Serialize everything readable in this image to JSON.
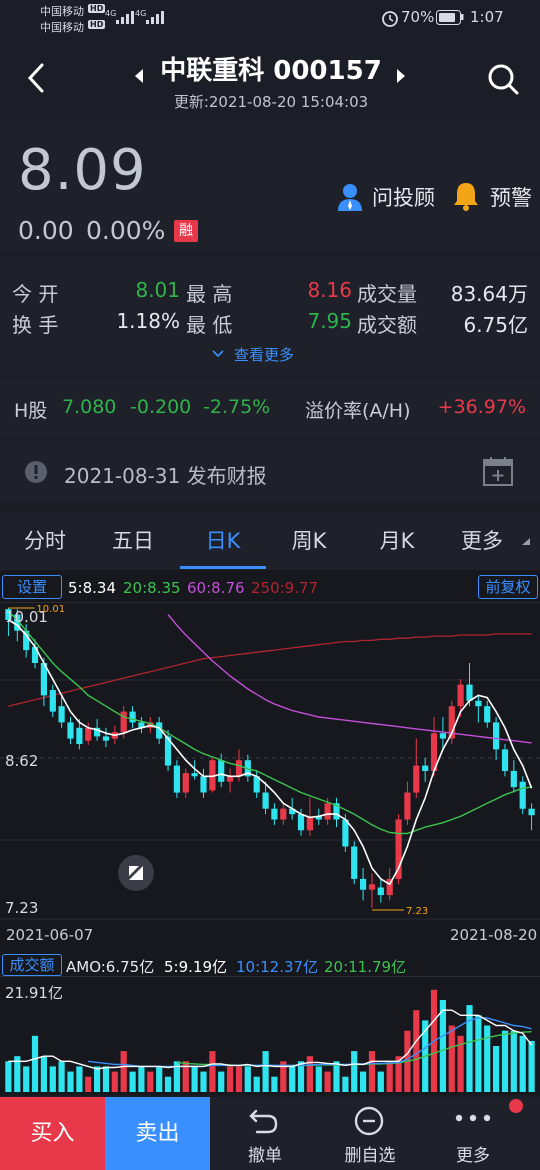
{
  "status_bar": {
    "carrier1": "中国移动",
    "carrier2": "中国移动",
    "hd": "HD",
    "net1": "4G",
    "net2": "4G",
    "battery": "70%",
    "time": "1:07"
  },
  "header": {
    "title": "中联重科 000157",
    "updated": "更新:2021-08-20 15:04:03"
  },
  "quote": {
    "price": "8.09",
    "change": "0.00",
    "change_pct": "0.00%",
    "margin_badge": "融",
    "advisor_label": "问投顾",
    "alert_label": "预警"
  },
  "stats": {
    "open_label": "今 开",
    "open_value": "8.01",
    "high_label": "最 高",
    "high_value": "8.16",
    "volume_label": "成交量",
    "volume_value": "83.64万",
    "turnover_label": "换 手",
    "turnover_value": "1.18%",
    "low_label": "最 低",
    "low_value": "7.95",
    "amount_label": "成交额",
    "amount_value": "6.75亿",
    "more_label": "查看更多"
  },
  "hshare": {
    "label": "H股",
    "price": "7.080",
    "change": "-0.200",
    "change_pct": "-2.75%",
    "premium_label": "溢价率(A/H)",
    "premium_value": "+36.97%"
  },
  "notice": {
    "text": "2021-08-31 发布财报"
  },
  "tabs": [
    "分时",
    "五日",
    "日K",
    "周K",
    "月K",
    "更多"
  ],
  "active_tab": "日K",
  "chart": {
    "settings_label": "设置",
    "ma5": "5:8.34",
    "ma20": "20:8.35",
    "ma60": "60:8.76",
    "ma250": "250:9.77",
    "adjust_label": "前复权",
    "y_top": "10.01",
    "y_mid": "8.62",
    "y_bottom": "7.23",
    "high_marker": "10.01",
    "low_marker": "7.23",
    "date_start": "2021-06-07",
    "date_end": "2021-08-20",
    "vol_label": "成交额",
    "amo": "AMO:6.75亿",
    "vol_ma5": "5:9.19亿",
    "vol_ma10": "10:12.37亿",
    "vol_ma20": "20:11.79亿",
    "vol_max": "21.91亿"
  },
  "colors": {
    "up": "#e8394a",
    "down": "#2fe4ef",
    "ma5": "#ffffff",
    "ma20": "#3cc34e",
    "ma60": "#c44fd8",
    "ma250": "#b0252e",
    "accent": "#3a8fff"
  },
  "bottom_bar": {
    "buy_label": "买入",
    "sell_label": "卖出",
    "cancel_label": "撤单",
    "remove_label": "删自选",
    "more_label": "更多"
  },
  "chart_data": {
    "type": "candlestick",
    "x_start": "2021-06-07",
    "x_end": "2021-08-20",
    "ylim": [
      7.23,
      10.01
    ],
    "candles": [
      [
        10.0,
        9.9,
        10.01,
        9.75
      ],
      [
        9.95,
        9.8,
        10.0,
        9.7
      ],
      [
        9.8,
        9.62,
        9.86,
        9.55
      ],
      [
        9.65,
        9.5,
        9.72,
        9.45
      ],
      [
        9.5,
        9.2,
        9.55,
        9.1
      ],
      [
        9.25,
        9.05,
        9.3,
        9.0
      ],
      [
        9.1,
        8.95,
        9.2,
        8.9
      ],
      [
        8.95,
        8.8,
        9.0,
        8.75
      ],
      [
        8.9,
        8.75,
        8.98,
        8.7
      ],
      [
        8.78,
        8.9,
        8.95,
        8.74
      ],
      [
        8.9,
        8.82,
        8.98,
        8.78
      ],
      [
        8.82,
        8.78,
        8.9,
        8.72
      ],
      [
        8.8,
        8.86,
        8.92,
        8.75
      ],
      [
        8.86,
        9.05,
        9.1,
        8.8
      ],
      [
        9.05,
        8.95,
        9.1,
        8.9
      ],
      [
        8.95,
        8.9,
        9.0,
        8.85
      ],
      [
        8.9,
        8.95,
        9.0,
        8.85
      ],
      [
        8.95,
        8.8,
        9.0,
        8.75
      ],
      [
        8.82,
        8.55,
        8.88,
        8.5
      ],
      [
        8.55,
        8.3,
        8.6,
        8.25
      ],
      [
        8.3,
        8.48,
        8.52,
        8.25
      ],
      [
        8.48,
        8.45,
        8.6,
        8.42
      ],
      [
        8.45,
        8.3,
        8.52,
        8.25
      ],
      [
        8.32,
        8.6,
        8.62,
        8.3
      ],
      [
        8.6,
        8.4,
        8.66,
        8.35
      ],
      [
        8.4,
        8.45,
        8.52,
        8.3
      ],
      [
        8.45,
        8.6,
        8.7,
        8.4
      ],
      [
        8.6,
        8.45,
        8.65,
        8.4
      ],
      [
        8.45,
        8.3,
        8.5,
        8.25
      ],
      [
        8.3,
        8.15,
        8.4,
        8.1
      ],
      [
        8.15,
        8.05,
        8.2,
        8.0
      ],
      [
        8.05,
        8.15,
        8.2,
        8.0
      ],
      [
        8.15,
        8.1,
        8.25,
        8.05
      ],
      [
        8.1,
        7.95,
        8.15,
        7.9
      ],
      [
        7.95,
        8.08,
        8.25,
        7.9
      ],
      [
        8.08,
        8.05,
        8.15,
        8.0
      ],
      [
        8.05,
        8.2,
        8.25,
        8.0
      ],
      [
        8.2,
        8.05,
        8.25,
        7.98
      ],
      [
        8.05,
        7.8,
        8.1,
        7.75
      ],
      [
        7.8,
        7.5,
        7.85,
        7.45
      ],
      [
        7.5,
        7.4,
        7.6,
        7.3
      ],
      [
        7.4,
        7.45,
        7.55,
        7.23
      ],
      [
        7.42,
        7.35,
        7.5,
        7.28
      ],
      [
        7.35,
        7.5,
        7.6,
        7.3
      ],
      [
        7.5,
        8.05,
        8.1,
        7.45
      ],
      [
        8.05,
        8.3,
        8.4,
        8.0
      ],
      [
        8.3,
        8.55,
        8.8,
        8.25
      ],
      [
        8.55,
        8.5,
        8.62,
        8.4
      ],
      [
        8.5,
        8.85,
        9.0,
        8.45
      ],
      [
        8.85,
        8.8,
        9.0,
        8.7
      ],
      [
        8.8,
        9.1,
        9.15,
        8.75
      ],
      [
        9.1,
        9.3,
        9.35,
        9.0
      ],
      [
        9.3,
        9.15,
        9.5,
        9.1
      ],
      [
        9.15,
        9.1,
        9.2,
        8.95
      ],
      [
        9.1,
        8.95,
        9.15,
        8.9
      ],
      [
        8.95,
        8.7,
        9.0,
        8.6
      ],
      [
        8.7,
        8.5,
        8.75,
        8.45
      ],
      [
        8.5,
        8.35,
        8.6,
        8.3
      ],
      [
        8.4,
        8.15,
        8.45,
        8.1
      ],
      [
        8.15,
        8.09,
        8.2,
        7.95
      ]
    ],
    "ma5": [
      9.9,
      9.85,
      9.76,
      9.65,
      9.5,
      9.35,
      9.2,
      9.05,
      8.95,
      8.9,
      8.88,
      8.85,
      8.83,
      8.85,
      8.88,
      8.9,
      8.92,
      8.9,
      8.8,
      8.7,
      8.6,
      8.52,
      8.45,
      8.45,
      8.47,
      8.45,
      8.45,
      8.48,
      8.45,
      8.38,
      8.3,
      8.2,
      8.15,
      8.1,
      8.07,
      8.08,
      8.1,
      8.1,
      8.05,
      7.95,
      7.8,
      7.6,
      7.5,
      7.45,
      7.6,
      7.8,
      8.05,
      8.25,
      8.5,
      8.7,
      8.85,
      9.05,
      9.15,
      9.2,
      9.18,
      9.05,
      8.9,
      8.7,
      8.55,
      8.34
    ],
    "ma20": [
      9.98,
      9.9,
      9.8,
      9.7,
      9.6,
      9.5,
      9.42,
      9.35,
      9.28,
      9.2,
      9.15,
      9.1,
      9.05,
      9.0,
      8.98,
      8.96,
      8.94,
      8.9,
      8.85,
      8.8,
      8.75,
      8.7,
      8.66,
      8.63,
      8.6,
      8.57,
      8.55,
      8.52,
      8.5,
      8.46,
      8.42,
      8.38,
      8.34,
      8.3,
      8.27,
      8.24,
      8.21,
      8.18,
      8.14,
      8.1,
      8.05,
      8.0,
      7.96,
      7.93,
      7.92,
      7.92,
      7.95,
      7.98,
      8.0,
      8.02,
      8.05,
      8.08,
      8.12,
      8.16,
      8.2,
      8.24,
      8.28,
      8.31,
      8.34,
      8.35
    ],
    "ma60_from_index": 18,
    "ma60": [
      9.95,
      9.85,
      9.76,
      9.68,
      9.6,
      9.52,
      9.45,
      9.38,
      9.32,
      9.26,
      9.21,
      9.16,
      9.12,
      9.09,
      9.06,
      9.04,
      9.02,
      9.0,
      8.99,
      8.98,
      8.97,
      8.96,
      8.95,
      8.94,
      8.93,
      8.92,
      8.91,
      8.9,
      8.89,
      8.88,
      8.87,
      8.86,
      8.85,
      8.84,
      8.83,
      8.82,
      8.81,
      8.8,
      8.79,
      8.78,
      8.77,
      8.76
    ],
    "ma250": [
      9.1,
      9.12,
      9.14,
      9.16,
      9.18,
      9.2,
      9.22,
      9.24,
      9.26,
      9.28,
      9.3,
      9.32,
      9.34,
      9.36,
      9.38,
      9.4,
      9.42,
      9.44,
      9.46,
      9.48,
      9.5,
      9.52,
      9.54,
      9.55,
      9.56,
      9.57,
      9.58,
      9.59,
      9.6,
      9.61,
      9.62,
      9.63,
      9.64,
      9.65,
      9.66,
      9.67,
      9.68,
      9.69,
      9.7,
      9.7,
      9.71,
      9.71,
      9.72,
      9.72,
      9.73,
      9.73,
      9.74,
      9.74,
      9.75,
      9.75,
      9.75,
      9.76,
      9.76,
      9.76,
      9.76,
      9.77,
      9.77,
      9.77,
      9.77,
      9.77
    ],
    "volume_ylim": [
      0,
      21.91
    ],
    "volume": [
      6,
      7,
      5,
      11,
      7,
      5,
      6,
      4,
      5,
      3,
      5,
      5,
      4,
      8,
      4,
      5,
      4,
      5,
      3,
      6,
      6,
      5,
      4,
      8,
      4,
      5,
      5,
      5,
      3,
      8,
      3,
      6,
      5,
      6,
      7,
      5,
      4,
      6,
      3,
      8,
      4,
      8,
      4,
      6,
      7,
      12,
      16,
      14,
      20,
      18,
      13,
      11,
      17,
      15,
      13,
      9,
      12,
      12,
      11,
      10
    ],
    "vol_ma5": [
      6,
      6,
      6,
      6.5,
      7,
      7,
      6,
      6,
      5.5,
      5,
      4.5,
      4.8,
      4.8,
      5,
      5,
      5,
      5,
      5,
      4.8,
      5,
      5,
      5,
      5,
      5.5,
      5.5,
      5.2,
      5.2,
      5.4,
      5,
      5.2,
      5,
      5,
      5,
      5.5,
      5.8,
      5.8,
      5.6,
      5.5,
      5.2,
      5.5,
      5.4,
      6,
      6,
      6,
      6,
      7.5,
      10,
      12,
      14,
      16,
      16,
      15,
      15,
      15,
      14,
      13,
      13,
      12,
      11.5,
      9.19
    ],
    "vol_ma10": [
      null,
      null,
      null,
      null,
      null,
      null,
      null,
      null,
      null,
      6,
      5.8,
      5.6,
      5.4,
      5.4,
      5.2,
      5,
      5,
      5,
      5,
      5,
      5,
      5,
      5,
      5.2,
      5.2,
      5.2,
      5.2,
      5.3,
      5.2,
      5.3,
      5.2,
      5.2,
      5.2,
      5.2,
      5.3,
      5.4,
      5.4,
      5.4,
      5.4,
      5.5,
      5.5,
      5.6,
      5.6,
      5.7,
      5.8,
      6.4,
      7.5,
      8.6,
      10,
      11,
      12,
      13,
      14,
      14.5,
      14.5,
      14,
      13.5,
      13,
      12.8,
      12.37
    ],
    "vol_ma20": [
      null,
      null,
      null,
      null,
      null,
      null,
      null,
      null,
      null,
      null,
      null,
      null,
      null,
      null,
      null,
      null,
      null,
      null,
      null,
      5.8,
      5.6,
      5.5,
      5.4,
      5.4,
      5.3,
      5.3,
      5.2,
      5.2,
      5.2,
      5.2,
      5.2,
      5.2,
      5.2,
      5.2,
      5.2,
      5.3,
      5.3,
      5.3,
      5.3,
      5.4,
      5.4,
      5.5,
      5.5,
      5.6,
      5.7,
      6,
      6.4,
      7,
      7.6,
      8.2,
      8.8,
      9.3,
      9.8,
      10.2,
      10.6,
      11,
      11.3,
      11.5,
      11.7,
      11.79
    ]
  }
}
